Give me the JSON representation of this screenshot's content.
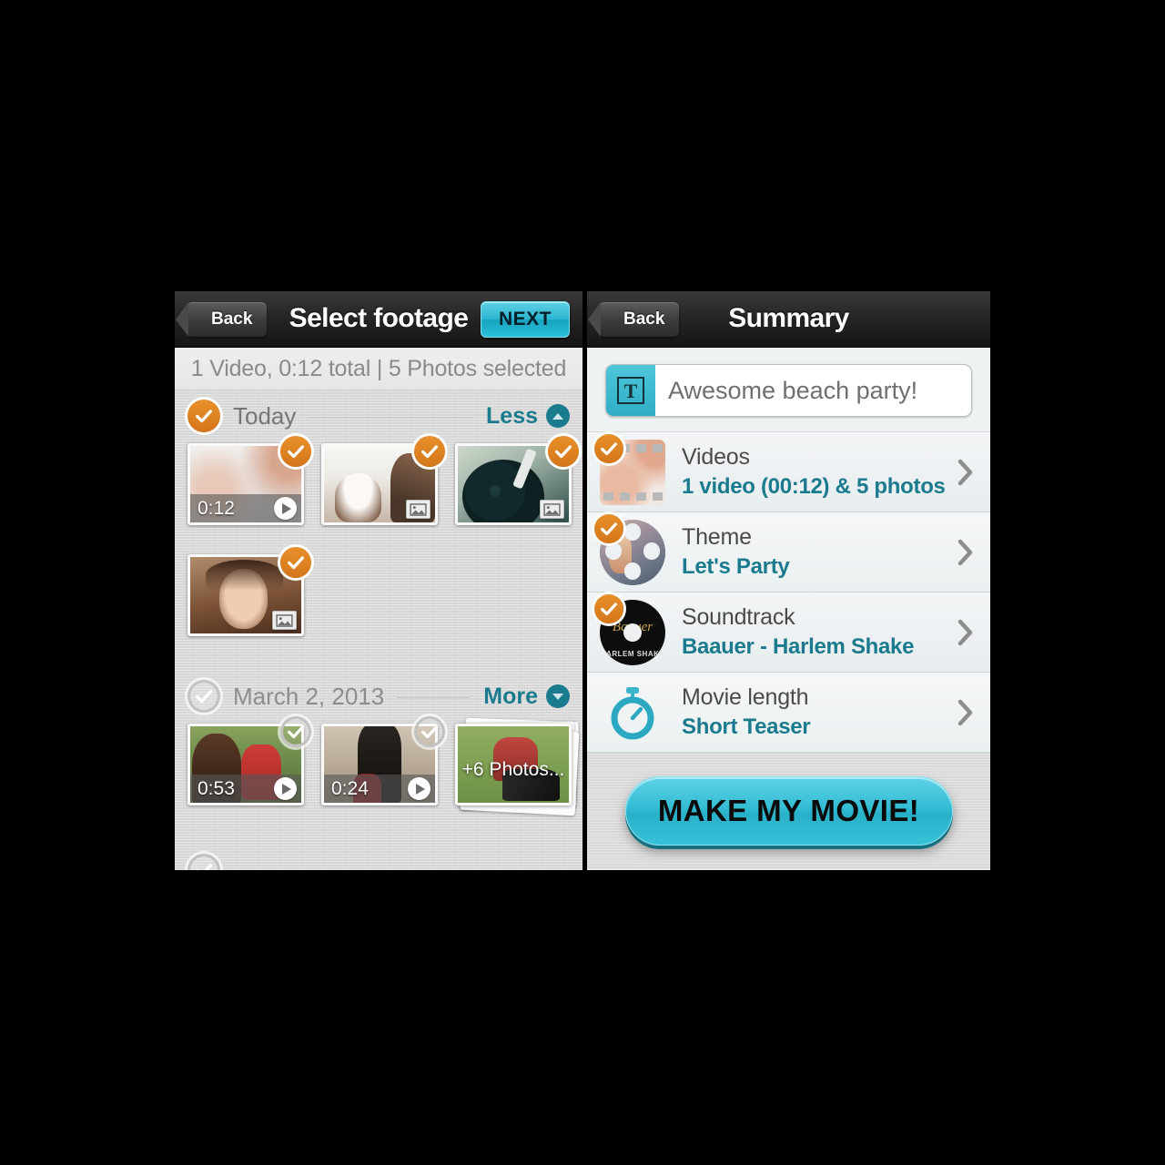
{
  "left": {
    "nav": {
      "back_label": "Back",
      "title": "Select footage",
      "next_label": "NEXT"
    },
    "status": "1 Video, 0:12 total | 5 Photos selected",
    "sections": [
      {
        "label": "Today",
        "checked": true,
        "toggle_label": "Less",
        "toggle_dir": "up",
        "items": [
          {
            "type": "video",
            "duration": "0:12",
            "checked": true
          },
          {
            "type": "photo",
            "checked": true
          },
          {
            "type": "photo",
            "checked": true
          },
          {
            "type": "photo",
            "checked": true
          }
        ]
      },
      {
        "label": "March 2, 2013",
        "checked": false,
        "toggle_label": "More",
        "toggle_dir": "down",
        "items": [
          {
            "type": "video",
            "duration": "0:53",
            "checked": false
          },
          {
            "type": "video",
            "duration": "0:24",
            "checked": false
          },
          {
            "type": "stack",
            "label": "+6 Photos..."
          }
        ]
      }
    ]
  },
  "right": {
    "nav": {
      "back_label": "Back",
      "title": "Summary"
    },
    "movie_title": {
      "value": "Awesome beach party!",
      "icon_letter": "T"
    },
    "rows": [
      {
        "key": "Videos",
        "value": "1 video (00:12) & 5 photos",
        "checked": true,
        "icon": "filmstrip"
      },
      {
        "key": "Theme",
        "value": "Let's Party",
        "checked": true,
        "icon": "film-reel"
      },
      {
        "key": "Soundtrack",
        "value": "Baauer - Harlem Shake",
        "checked": true,
        "icon": "cd",
        "cd_title": "Baauer",
        "cd_sub": "HARLEM SHAKE"
      },
      {
        "key": "Movie length",
        "value": "Short Teaser",
        "checked": false,
        "icon": "stopwatch"
      }
    ],
    "cta_label": "MAKE MY MOVIE!"
  },
  "colors": {
    "accent_teal": "#2bb6d0",
    "link_teal": "#1b7b8e",
    "check_orange": "#d4761a",
    "nav_black": "#1f1f1f"
  }
}
